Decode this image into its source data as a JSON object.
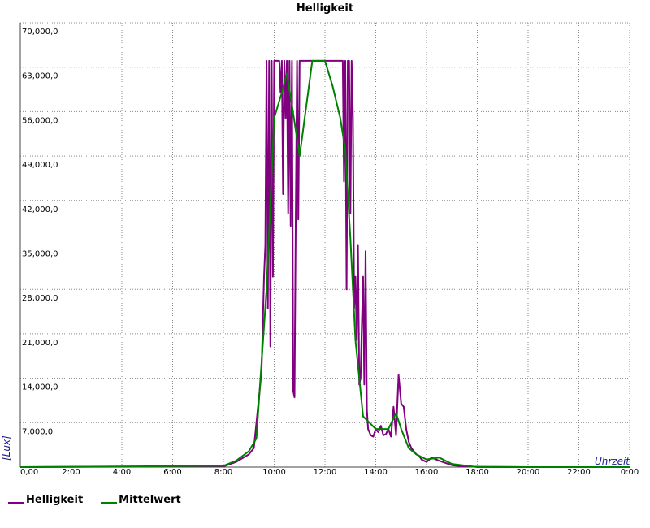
{
  "chart_data": {
    "type": "line",
    "title": "Helligkeit",
    "xlabel": "Uhrzeit",
    "ylabel": "[Lux]",
    "xlim": [
      0,
      24
    ],
    "ylim": [
      0,
      70000
    ],
    "grid": true,
    "legend_position": "bottom-left",
    "x_ticks": [
      "0,00",
      "2:00",
      "4:00",
      "6:00",
      "8:00",
      "10:00",
      "12:00",
      "14:00",
      "16:00",
      "18:00",
      "20:00",
      "22:00",
      "0:00"
    ],
    "y_ticks": [
      "7,000,0",
      "14,000,0",
      "21,000,0",
      "28,000,0",
      "35,000,0",
      "42,000,0",
      "49,000,0",
      "56,000,0",
      "63,000,0",
      "70,000,0"
    ],
    "series": [
      {
        "name": "Helligkeit",
        "color": "#800080",
        "x": [
          0,
          8.0,
          8.5,
          9.0,
          9.2,
          9.5,
          9.6,
          9.65,
          9.7,
          9.75,
          9.8,
          9.85,
          9.9,
          9.95,
          10.0,
          10.1,
          10.2,
          10.25,
          10.3,
          10.35,
          10.4,
          10.45,
          10.5,
          10.55,
          10.6,
          10.65,
          10.7,
          10.75,
          10.8,
          10.85,
          10.9,
          10.95,
          11.0,
          11.1,
          11.2,
          11.5,
          11.8,
          12.0,
          12.1,
          12.3,
          12.5,
          12.7,
          12.75,
          12.8,
          12.85,
          12.9,
          12.95,
          13.0,
          13.05,
          13.1,
          13.15,
          13.2,
          13.25,
          13.3,
          13.35,
          13.4,
          13.45,
          13.5,
          13.55,
          13.6,
          13.65,
          13.7,
          13.75,
          13.8,
          13.9,
          14.0,
          14.1,
          14.2,
          14.3,
          14.4,
          14.5,
          14.6,
          14.7,
          14.8,
          14.9,
          15.0,
          15.1,
          15.2,
          15.3,
          15.4,
          15.5,
          15.6,
          15.7,
          15.8,
          16.0,
          16.2,
          16.5,
          17.0,
          17.5,
          18.0,
          19.0,
          20.0,
          22.0,
          24.0
        ],
        "y": [
          0,
          100,
          800,
          2000,
          3000,
          15000,
          30000,
          35000,
          64000,
          25000,
          64000,
          19000,
          64000,
          30000,
          64000,
          64000,
          64000,
          59000,
          64000,
          43000,
          64000,
          55000,
          64000,
          40000,
          64000,
          38000,
          64000,
          12000,
          11000,
          40000,
          64000,
          39000,
          64000,
          64000,
          64000,
          64000,
          64000,
          64000,
          64000,
          64000,
          64000,
          64000,
          45000,
          64000,
          28000,
          64000,
          64000,
          40000,
          64000,
          55000,
          25000,
          30000,
          20000,
          35000,
          13000,
          14000,
          22000,
          30000,
          13000,
          34000,
          9000,
          6000,
          5500,
          5000,
          4800,
          6000,
          5500,
          6500,
          5000,
          5200,
          6000,
          4800,
          9500,
          5000,
          14500,
          10000,
          9500,
          6000,
          4000,
          3000,
          2500,
          2000,
          1800,
          1200,
          800,
          1500,
          1000,
          300,
          100,
          50,
          20,
          0,
          0,
          0
        ]
      },
      {
        "name": "Mittelwert",
        "color": "#008000",
        "x": [
          0,
          8.0,
          8.5,
          9.0,
          9.3,
          9.7,
          10.0,
          10.3,
          10.5,
          10.7,
          11.0,
          11.5,
          11.8,
          12.0,
          12.3,
          12.6,
          12.8,
          13.0,
          13.2,
          13.5,
          14.0,
          14.5,
          14.8,
          15.0,
          15.3,
          15.6,
          16.0,
          16.5,
          17.0,
          18.0,
          24.0
        ],
        "y": [
          0,
          200,
          1000,
          2500,
          4500,
          28000,
          55000,
          59000,
          62000,
          57000,
          49000,
          64000,
          64000,
          64000,
          60000,
          55000,
          50000,
          36000,
          20000,
          8000,
          6000,
          6000,
          8500,
          6000,
          3000,
          2000,
          1200,
          1500,
          500,
          0,
          0
        ]
      }
    ]
  },
  "legend": [
    {
      "label": "Helligkeit",
      "color": "#800080"
    },
    {
      "label": "Mittelwert",
      "color": "#008000"
    }
  ]
}
